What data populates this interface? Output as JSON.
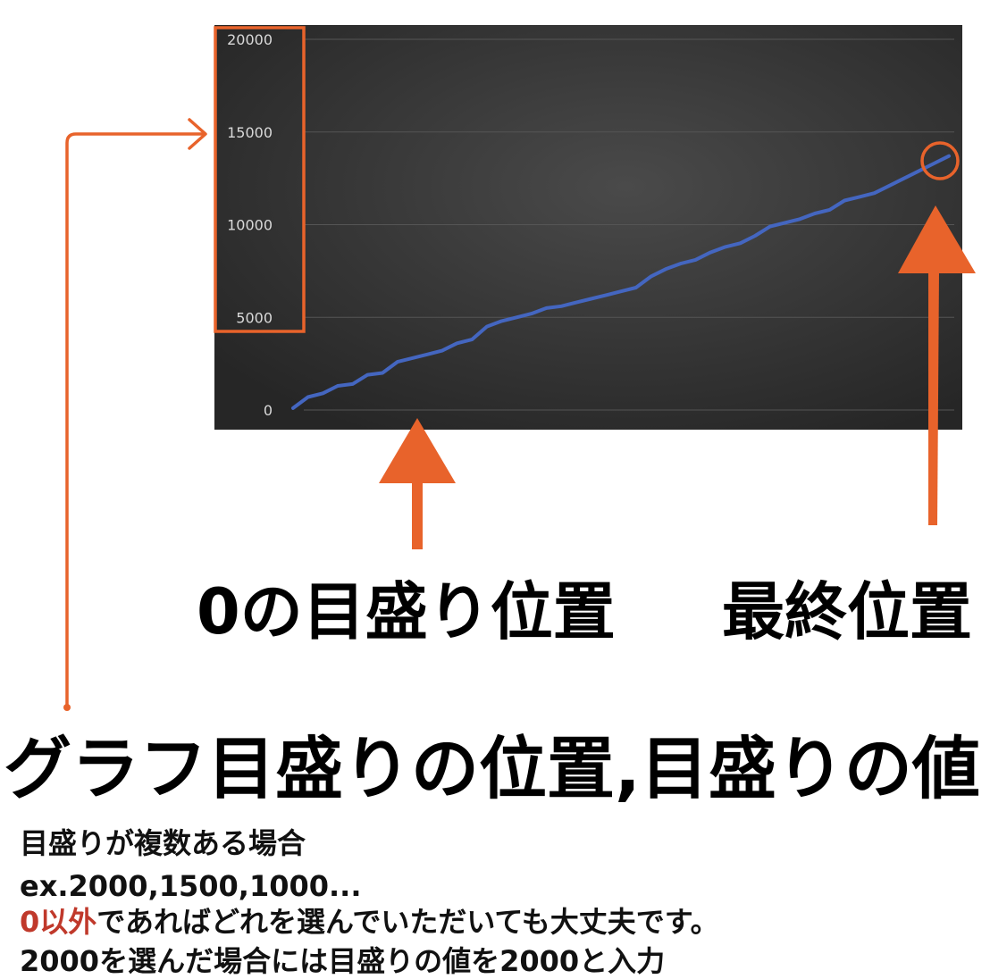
{
  "chart_data": {
    "type": "line",
    "title": "",
    "xlabel": "",
    "ylabel": "",
    "ylim": [
      0,
      20000
    ],
    "y_ticks": [
      0,
      5000,
      10000,
      15000,
      20000
    ],
    "y_tick_labels": [
      "0",
      "5000",
      "10000",
      "15000",
      "20000"
    ],
    "grid": true,
    "legend": "none",
    "series": [
      {
        "values": [
          100,
          700,
          900,
          1300,
          1400,
          1900,
          2000,
          2600,
          2800,
          3000,
          3200,
          3600,
          3800,
          4500,
          4800,
          5000,
          5200,
          5500,
          5600,
          5800,
          6000,
          6200,
          6400,
          6600,
          7200,
          7600,
          7900,
          8100,
          8500,
          8800,
          9000,
          9400,
          9900,
          10100,
          10300,
          10600,
          10800,
          11300,
          11500,
          11700,
          12100,
          12500,
          12900,
          13300,
          13700
        ]
      }
    ],
    "colors": {
      "background_center": "#4a4a4a",
      "background_edge": "#262626",
      "line": "#4466c0",
      "gridline": "#555555",
      "tick_text": "#d9d9d9"
    }
  },
  "annotations": {
    "accent_color": "#e8632b",
    "zero_position_label": "0の目盛り位置",
    "final_position_label": "最終位置"
  },
  "heading": "グラフ目盛りの位置,目盛りの値",
  "description": {
    "line1": "目盛りが複数ある場合",
    "line2": "ex.2000,1500,1000...",
    "line3_red": "0以外",
    "line3_rest": "であればどれを選んでいただいても大丈夫です。",
    "line4": "2000を選んだ場合には目盛りの値を2000と入力",
    "red_color": "#c0392b"
  }
}
